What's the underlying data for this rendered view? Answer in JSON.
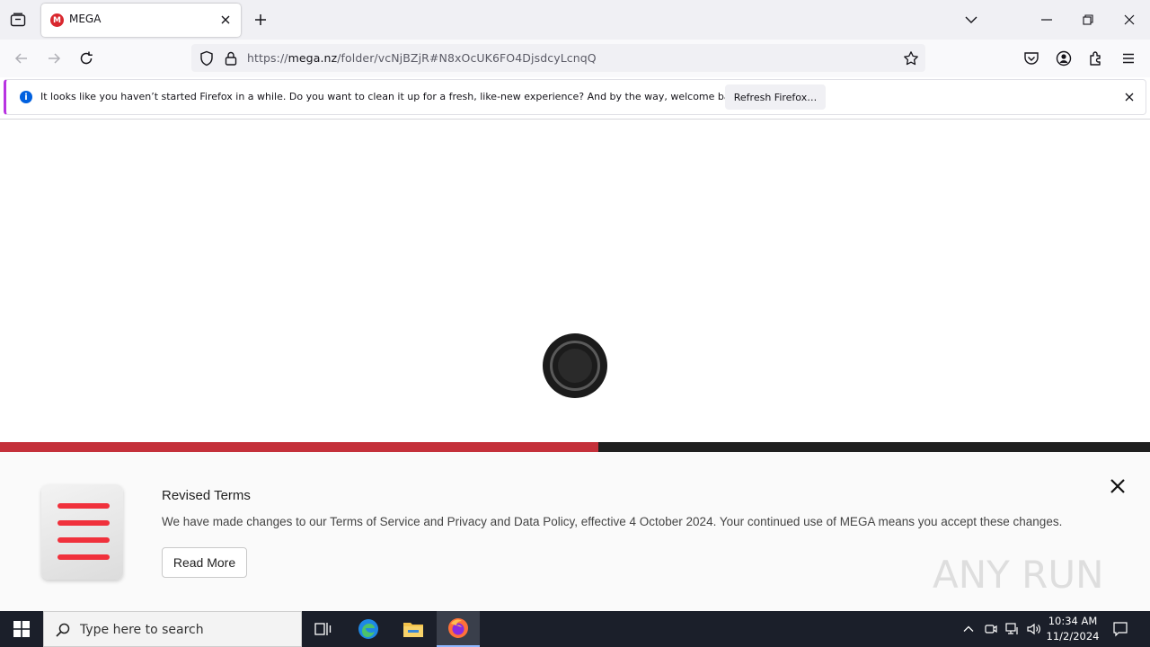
{
  "browser": {
    "tab": {
      "title": "MEGA",
      "favicon_letter": "M"
    },
    "url": {
      "prefix": "https://",
      "host": "mega.nz",
      "path": "/folder/vcNjBZjR#N8xOcUK6FO4DjsdcyLcnqQ"
    },
    "notification": {
      "message": "It looks like you haven’t started Firefox in a while. Do you want to clean it up for a fresh, like-new experience? And by the way, welcome back!",
      "button_label": "Refresh Firefox…"
    }
  },
  "page": {
    "loading_progress_percent": 52,
    "terms": {
      "title": "Revised Terms",
      "body": "We have made changes to our Terms of Service and Privacy and Data Policy, effective 4 October 2024. Your continued use of MEGA means you accept these changes.",
      "read_more_label": "Read More"
    },
    "watermark_text": "ANY RUN"
  },
  "taskbar": {
    "search_placeholder": "Type here to search",
    "time": "10:34 AM",
    "date": "11/2/2024"
  },
  "colors": {
    "accent_red": "#c4303a",
    "firefox_blue": "#0060df",
    "notif_stripe": "#b833e1",
    "taskbar_bg": "#1b1f2a"
  }
}
